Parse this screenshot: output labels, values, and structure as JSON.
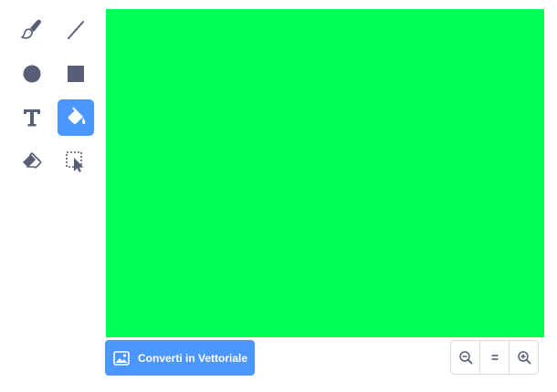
{
  "tools": [
    {
      "name": "brush",
      "icon": "brush-icon",
      "selected": false
    },
    {
      "name": "line",
      "icon": "line-icon",
      "selected": false
    },
    {
      "name": "circle",
      "icon": "circle-icon",
      "selected": false
    },
    {
      "name": "rectangle",
      "icon": "rectangle-icon",
      "selected": false
    },
    {
      "name": "text",
      "icon": "text-icon",
      "selected": false
    },
    {
      "name": "fill",
      "icon": "fill-bucket-icon",
      "selected": true
    },
    {
      "name": "eraser",
      "icon": "eraser-icon",
      "selected": false
    },
    {
      "name": "select",
      "icon": "select-icon",
      "selected": false
    }
  ],
  "canvas": {
    "fill_color": "#00ff55"
  },
  "colors": {
    "accent": "#4c97ff",
    "icon_dark": "#575e75",
    "border": "#d9dde6"
  },
  "bottom_bar": {
    "convert_label": "Converti in Vettoriale",
    "convert_icon": "image-icon",
    "zoom_out_icon": "zoom-out-icon",
    "zoom_reset_icon": "zoom-reset-icon",
    "zoom_in_icon": "zoom-in-icon"
  }
}
